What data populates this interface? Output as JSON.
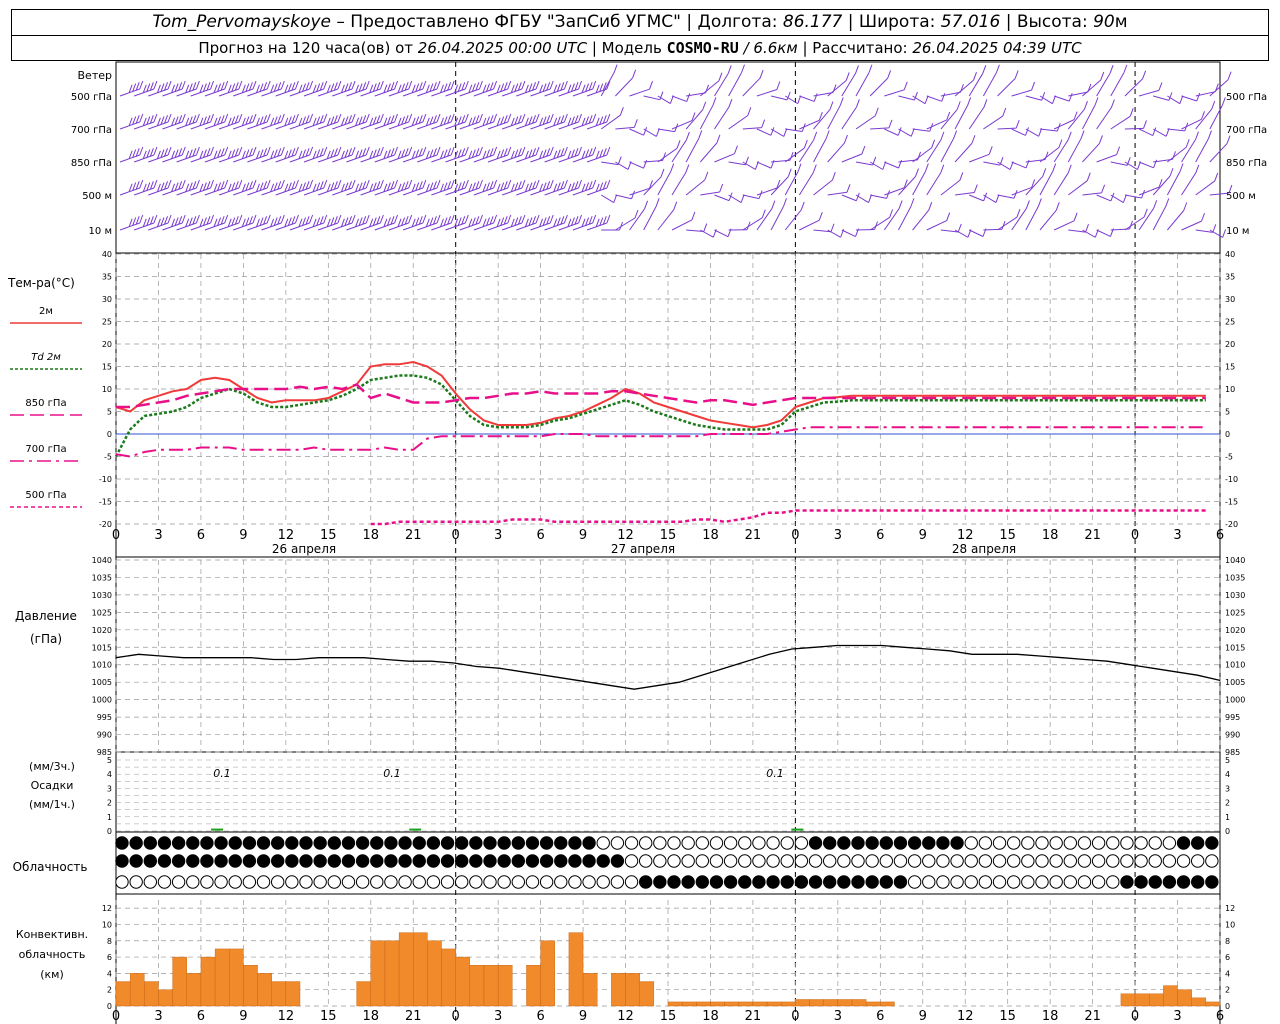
{
  "header": {
    "station": "Tom_Pervomayskoye",
    "provided_by": "– Предоставлено ФГБУ \"ЗапСиб УГМС\" |",
    "lon_label": "Долгота:",
    "lon_value": "86.177",
    "lat_label": "| Широта:",
    "lat_value": "57.016",
    "alt_label": "| Высота:",
    "alt_value": "90",
    "alt_unit": "м",
    "forecast_label": "Прогноз на 120 часа(ов) от",
    "forecast_start": "26.04.2025 00:00 UTC",
    "model_label": "| Модель",
    "model_name": "COSMO-RU",
    "model_res": "/ 6.6км",
    "computed_label": "| Рассчитано:",
    "computed_time": "26.04.2025 04:39 UTC"
  },
  "labels": {
    "wind": "Ветер",
    "wind_levels": [
      "500 гПа",
      "700 гПа",
      "850 гПа",
      "500 м",
      "10  м"
    ],
    "temp_title": "Тем-ра(°C)",
    "temp_legend": [
      "2м",
      "Td  2м",
      "850 гПа",
      "700 гПа",
      "500 гПа"
    ],
    "pressure_title": "Давление",
    "pressure_unit": "(гПа)",
    "precip_unit3": "(мм/3ч.)",
    "precip_title": "Осадки",
    "precip_unit1": "(мм/1ч.)",
    "cloud_title": "Облачность",
    "conv_title1": "Конвективн.",
    "conv_title2": "облачность",
    "conv_unit": "(км)",
    "dates": [
      "26 апреля",
      "27 апреля",
      "28 апреля"
    ],
    "precip_values": [
      "0.1",
      "0.1",
      "0.1"
    ]
  },
  "colors": {
    "t2m": "#f03a3a",
    "td2m": "#1a7a1a",
    "t850": "#e8108a",
    "t700": "#e8108a",
    "t500": "#e8108a",
    "wind": "#7a3ad0",
    "conv": "#f08a2a",
    "zero": "#3050d0",
    "pressure": "#000000",
    "precip": "#1aa01a"
  },
  "chart_data": [
    {
      "type": "line",
      "title": "Тем-ра(°C)",
      "x_hours": [
        0,
        1,
        2,
        3,
        4,
        5,
        6,
        7,
        8,
        9,
        10,
        11,
        12,
        13,
        14,
        15,
        16,
        17,
        18,
        19,
        20,
        21,
        22,
        23,
        24,
        25,
        26,
        27,
        28,
        29,
        30,
        31,
        32,
        33,
        34,
        35,
        36,
        37,
        38,
        39,
        40,
        41,
        42,
        43,
        44,
        45,
        46,
        47,
        48,
        49,
        50,
        51,
        52,
        53,
        54,
        55,
        56,
        57,
        58,
        59,
        60,
        61,
        62,
        63,
        64,
        65,
        66,
        67,
        68,
        69,
        70,
        71,
        72,
        73,
        74,
        75,
        76,
        77
      ],
      "x_tick_labels": [
        "0",
        "3",
        "6",
        "9",
        "12",
        "15",
        "18",
        "21",
        "0",
        "3",
        "6",
        "9",
        "12",
        "15",
        "18",
        "21",
        "0",
        "3",
        "6",
        "9",
        "12",
        "15",
        "18",
        "21",
        "0",
        "3",
        "6"
      ],
      "ylim": [
        -20,
        40
      ],
      "series": [
        {
          "name": "2м",
          "values": [
            6,
            5,
            7.5,
            8.5,
            9.5,
            10,
            12,
            12.5,
            12,
            10,
            8,
            7,
            7.5,
            7.5,
            7.5,
            8,
            9.5,
            11,
            15,
            15.5,
            15.5,
            16,
            15,
            13,
            9,
            5.5,
            3,
            2,
            2,
            2,
            2.5,
            3.5,
            4,
            5,
            6.5,
            8,
            10,
            9,
            7,
            6,
            5,
            4,
            3,
            2.5,
            2,
            1.5,
            2,
            3,
            6,
            7,
            8,
            8.2,
            8.5,
            8.5,
            8.5,
            8.5,
            8.5,
            8.5,
            8.5,
            8.5,
            8.5,
            8.5,
            8.5,
            8.5,
            8.5,
            8.5,
            8.5,
            8.5,
            8.5,
            8.5,
            8.5,
            8.5,
            8.5,
            8.5,
            8.5,
            8.5,
            8.5,
            8.5
          ]
        },
        {
          "name": "Td  2м",
          "values": [
            -5,
            1,
            4,
            4.5,
            5,
            6,
            8,
            9,
            10,
            9,
            7,
            6,
            6,
            6.5,
            7,
            7.5,
            8.5,
            10,
            12,
            12.5,
            13,
            13,
            12.5,
            11,
            7.5,
            4,
            2,
            1.5,
            1.5,
            1.5,
            2,
            3,
            3.5,
            4.5,
            5.5,
            6.5,
            7.5,
            6.5,
            5,
            4,
            3,
            2,
            1.5,
            1,
            1,
            1,
            1,
            2,
            5,
            6,
            7,
            7.2,
            7.5,
            7.5,
            7.5,
            7.5,
            7.5,
            7.5,
            7.5,
            7.5,
            7.5,
            7.5,
            7.5,
            7.5,
            7.5,
            7.5,
            7.5,
            7.5,
            7.5,
            7.5,
            7.5,
            7.5,
            7.5,
            7.5,
            7.5,
            7.5,
            7.5,
            7.5
          ]
        },
        {
          "name": "850 гПа",
          "values": [
            6,
            6,
            6.5,
            7,
            7.5,
            8.5,
            9,
            9.5,
            10,
            10,
            10,
            10,
            10,
            10.5,
            10,
            10.5,
            10,
            11,
            8,
            9,
            8,
            7,
            7,
            7,
            7.5,
            8,
            8,
            8.5,
            9,
            9,
            9.5,
            9,
            9,
            9,
            9,
            9.5,
            9.5,
            9,
            8.5,
            8,
            7.5,
            7,
            7.5,
            7.5,
            7,
            6.5,
            7,
            7.5,
            8,
            8,
            8,
            8,
            8,
            8,
            8,
            8,
            8,
            8,
            8,
            8,
            8,
            8,
            8,
            8,
            8,
            8,
            8,
            8,
            8,
            8,
            8,
            8,
            8,
            8,
            8,
            8,
            8,
            8
          ]
        },
        {
          "name": "700 гПа",
          "values": [
            -4.5,
            -5,
            -4,
            -3.5,
            -3.5,
            -3.5,
            -3,
            -3,
            -3,
            -3.5,
            -3.5,
            -3.5,
            -3.5,
            -3.5,
            -3,
            -3.5,
            -3.5,
            -3.5,
            -3.5,
            -3,
            -3.5,
            -3.5,
            -1,
            -0.5,
            -0.5,
            -0.5,
            -0.5,
            -0.5,
            -0.5,
            -0.5,
            -0.5,
            0,
            0,
            0,
            -0.5,
            -0.5,
            -0.5,
            -0.5,
            -0.5,
            -0.5,
            -0.5,
            -0.5,
            0,
            0,
            0,
            0,
            0,
            0.5,
            1,
            1.5,
            1.5,
            1.5,
            1.5,
            1.5,
            1.5,
            1.5,
            1.5,
            1.5,
            1.5,
            1.5,
            1.5,
            1.5,
            1.5,
            1.5,
            1.5,
            1.5,
            1.5,
            1.5,
            1.5,
            1.5,
            1.5,
            1.5,
            1.5,
            1.5,
            1.5,
            1.5,
            1.5,
            1.5
          ]
        },
        {
          "name": "500 гПа",
          "values": [
            null,
            null,
            null,
            null,
            null,
            null,
            null,
            null,
            null,
            null,
            null,
            null,
            null,
            null,
            null,
            null,
            null,
            null,
            -20,
            -20,
            -19.5,
            -19.5,
            -19.5,
            -19.5,
            -19.5,
            -19.5,
            -19.5,
            -19.5,
            -19,
            -19,
            -19,
            -19.5,
            -19.5,
            -19.5,
            -19.5,
            -19.5,
            -19.5,
            -19.5,
            -19.5,
            -19.5,
            -19.5,
            -19,
            -19,
            -19.5,
            -19,
            -18.5,
            -17.5,
            -17.5,
            -17,
            -17,
            -17,
            -17,
            -17,
            -17,
            -17,
            -17,
            -17,
            -17,
            -17,
            -17,
            -17,
            -17,
            -17,
            -17,
            -17,
            -17,
            -17,
            -17,
            -17,
            -17,
            -17,
            -17,
            -17,
            -17,
            -17,
            -17,
            -17,
            -17
          ]
        }
      ]
    },
    {
      "type": "line",
      "title": "Давление",
      "ylabel": "(гПа)",
      "ylim": [
        985,
        1040
      ],
      "series": [
        {
          "name": "",
          "values": [
            1012,
            1013,
            1012.5,
            1012,
            1012,
            1012,
            1012,
            1011.5,
            1011.5,
            1012,
            1012,
            1012,
            1011.5,
            1011,
            1011,
            1010.5,
            1009.5,
            1009,
            1008,
            1007,
            1006,
            1005,
            1004,
            1003,
            1004,
            1005,
            1007,
            1009,
            1011,
            1013,
            1014.5,
            1015,
            1015.5,
            1015.5,
            1015.5,
            1015,
            1014.5,
            1014,
            1013,
            1013,
            1013,
            1012.5,
            1012,
            1011.5,
            1011,
            1010,
            1009,
            1008,
            1007,
            1005.5
          ]
        }
      ]
    },
    {
      "type": "bar",
      "title": "Конвективн. облачность",
      "ylabel": "(км)",
      "ylim": [
        0,
        13
      ],
      "values": [
        3,
        4,
        3,
        2,
        6,
        4,
        6,
        7,
        7,
        5,
        4,
        3,
        3,
        0,
        0,
        0,
        0,
        3,
        8,
        8,
        9,
        9,
        8,
        7,
        6,
        5,
        5,
        5,
        0,
        5,
        8,
        0,
        9,
        4,
        0,
        4,
        4,
        3,
        0,
        0.5,
        0.5,
        0.5,
        0.5,
        0.5,
        0.5,
        0.5,
        0.5,
        0.5,
        0.8,
        0.8,
        0.8,
        0.8,
        0.8,
        0.5,
        0.5,
        0,
        0,
        0,
        0,
        0,
        0,
        0,
        0,
        0,
        0,
        0,
        0,
        0,
        0,
        0,
        0,
        1.5,
        1.5,
        1.5,
        2.5,
        2,
        1,
        0.5
      ]
    },
    {
      "type": "bar",
      "title": "Осадки",
      "ylim": [
        0,
        5
      ],
      "values": [
        0.1,
        0.1,
        0.1
      ]
    }
  ]
}
